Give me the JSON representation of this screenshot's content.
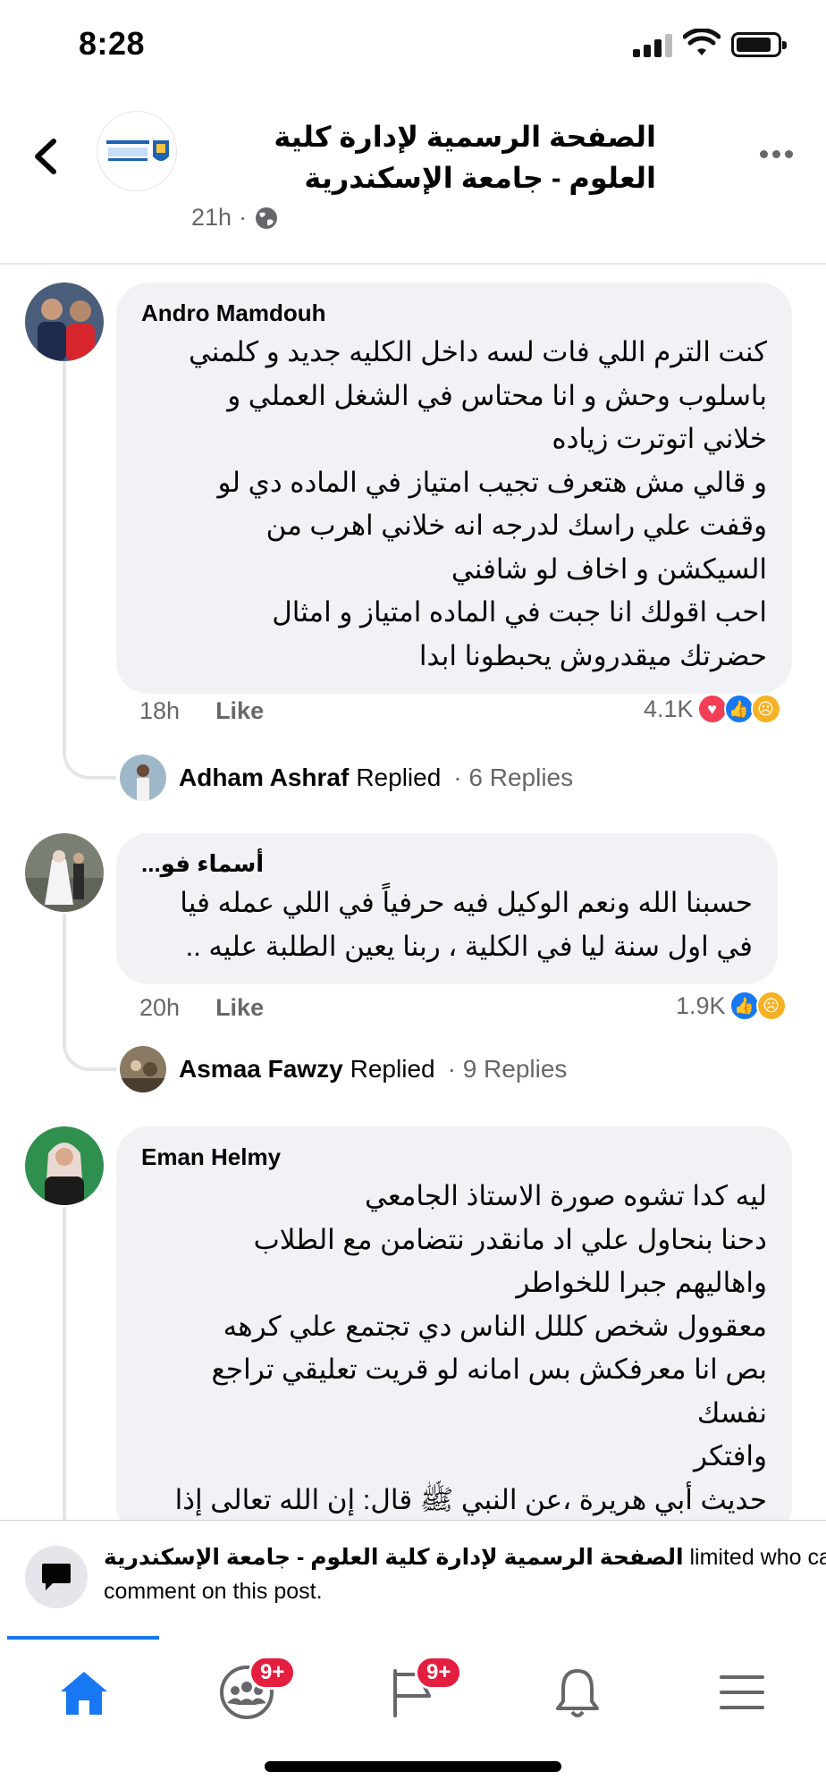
{
  "status": {
    "time": "8:28"
  },
  "post": {
    "page_name": "الصفحة الرسمية لإدارة كلية العلوم - جامعة الإسكندرية",
    "time": "21h",
    "separator": "·",
    "privacy_icon": "globe-icon"
  },
  "comments": [
    {
      "author": "Andro Mamdouh",
      "text_lines": [
        "كنت الترم اللي فات لسه داخل الكليه جديد و كلمني",
        "باسلوب وحش و انا محتاس في الشغل العملي و",
        "خلاني اتوترت زياده",
        "و قالي مش هتعرف تجيب امتياز في الماده دي لو",
        "وقفت علي راسك لدرجه انه خلاني اهرب من",
        "السيكشن و اخاف لو شافني",
        "احب اقولك انا جبت في الماده امتياز و امثال",
        "حضرتك ميقدروش يحبطونا ابدا"
      ],
      "time": "18h",
      "like_label": "Like",
      "reaction_count": "4.1K",
      "replier": "Adham Ashraf",
      "replied_label": "Replied",
      "reply_count": "· 6 Replies"
    },
    {
      "author": "أسماء فو...",
      "text_lines": [
        "حسبنا الله ونعم الوكيل فيه حرفياً في اللي عمله فيا",
        "في اول سنة ليا في الكلية ، ربنا يعين الطلبة عليه .."
      ],
      "time": "20h",
      "like_label": "Like",
      "reaction_count": "1.9K",
      "replier": "Asmaa Fawzy",
      "replied_label": "Replied",
      "reply_count": "· 9 Replies"
    },
    {
      "author": "Eman Helmy",
      "text_lines": [
        "ليه كدا تشوه صورة الاستاذ الجامعي",
        "دحنا بنحاول علي اد مانقدر نتضامن مع الطلاب",
        "واهاليهم جبرا للخواطر",
        "معقوول شخص كللل الناس دي تجتمع علي كرهه",
        "بص انا معرفكش بس امانه لو قريت تعليقي تراجع",
        "نفسك",
        "وافتكر",
        "حديث أبي هريرة ،عن النبي ﷺ قال: إن الله تعالى إذا"
      ]
    }
  ],
  "limit_banner": {
    "page_name": "الصفحة الرسمية لإدارة كلية العلوم - جامعة الإسكندرية",
    "message_part1": " limited who can",
    "message_part2": "comment on this post."
  },
  "tabs": [
    {
      "name": "home",
      "icon": "home-icon",
      "badge": ""
    },
    {
      "name": "groups",
      "icon": "groups-icon",
      "badge": "9+"
    },
    {
      "name": "pages",
      "icon": "flag-icon",
      "badge": "9+"
    },
    {
      "name": "notifications",
      "icon": "bell-icon",
      "badge": ""
    },
    {
      "name": "menu",
      "icon": "menu-icon",
      "badge": ""
    }
  ],
  "colors": {
    "accent": "#1877f2",
    "bubble": "#f0f2f5",
    "badge": "#e41e3f",
    "love": "#f33e58",
    "sad": "#f7b125"
  }
}
